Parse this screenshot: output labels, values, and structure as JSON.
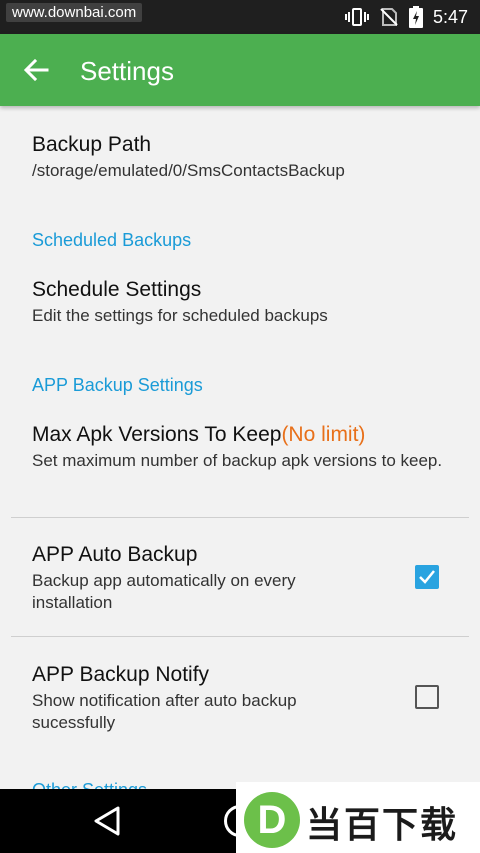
{
  "status_bar": {
    "watermark": "www.downbai.com",
    "time": "5:47",
    "icons": [
      "vibrate-icon",
      "no-sim-icon",
      "battery-charging-icon"
    ]
  },
  "app_bar": {
    "back_icon": "arrow-left-icon",
    "title": "Settings"
  },
  "preferences": {
    "backup_path": {
      "title": "Backup Path",
      "summary": "/storage/emulated/0/SmsContactsBackup"
    },
    "scheduled_category": "Scheduled Backups",
    "schedule_settings": {
      "title": "Schedule Settings",
      "summary": "Edit the settings for scheduled backups"
    },
    "app_backup_category": "APP Backup Settings",
    "max_apk": {
      "title": "Max Apk Versions To Keep",
      "value": "(No limit)",
      "summary": "Set maximum number of backup apk versions to keep."
    },
    "auto_backup": {
      "title": "APP Auto Backup",
      "summary": "Backup app automatically on every installation",
      "checked": true
    },
    "backup_notify": {
      "title": "APP Backup Notify",
      "summary": "Show notification after auto backup sucessfully",
      "checked": false
    },
    "other_category": "Other Settings"
  },
  "navigation_bar": {
    "icons": [
      "back-triangle-icon",
      "home-circle-icon"
    ]
  },
  "brand_watermark": {
    "logo_letter": "D",
    "text": "当百下载"
  },
  "colors": {
    "app_bar": "#4caf50",
    "category": "#1a9bd7",
    "accent_checkbox": "#29a3e0",
    "value_highlight": "#e8701a"
  }
}
